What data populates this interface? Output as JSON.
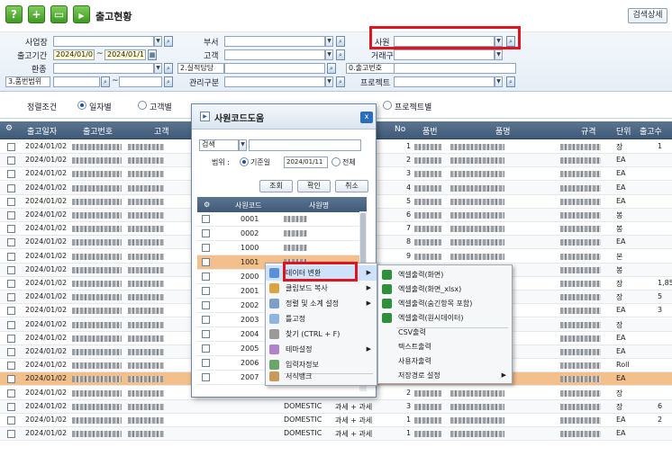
{
  "toolbar": {
    "help_label": "?",
    "add_label": "+",
    "page_title": "출고현황",
    "detail_search_label": "검색상세"
  },
  "filters": {
    "business_label": "사업장",
    "dept_label": "부서",
    "employee_label": "사원",
    "period_label": "출고기간",
    "date_from": "2024/01/01",
    "date_sep": "~",
    "date_to": "2024/01/11",
    "customer_label": "고객",
    "trade_type_label": "거래구분",
    "currency_label": "환종",
    "perf_owner_label": "2.실적담당",
    "ship_no_label": "0.출고번호",
    "item_range_label": "3.품번범위",
    "mgmt_type_label": "관리구분",
    "project_label": "프로젝트"
  },
  "sort": {
    "label": "정렬조건",
    "options": [
      "일자별",
      "고객별",
      "프로젝트별"
    ],
    "selected": "일자별"
  },
  "grid": {
    "columns": [
      "출고일자",
      "출고번호",
      "고객",
      "No",
      "품번",
      "품명",
      "규격",
      "단위",
      "출고수"
    ],
    "dates": [
      "2024/01/02",
      "2024/01/02",
      "2024/01/02",
      "2024/01/02",
      "2024/01/02",
      "2024/01/02",
      "2024/01/02",
      "2024/01/02",
      "2024/01/02",
      "2024/01/02",
      "2024/01/02",
      "2024/01/02",
      "2024/01/02",
      "2024/01/02",
      "2024/01/02",
      "2024/01/02",
      "2024/01/02",
      "2024/01/02",
      "2024/01/02",
      "2024/01/02",
      "2024/01/02",
      "2024/01/02"
    ],
    "nos": [
      "1",
      "2",
      "3",
      "4",
      "5",
      "6",
      "7",
      "8",
      "9",
      "1",
      "2",
      "1",
      "2",
      "3",
      "1",
      "2",
      "3",
      "1",
      "2",
      "3",
      "1",
      "1"
    ],
    "units": [
      "장",
      "EA",
      "EA",
      "EA",
      "EA",
      "봉",
      "봉",
      "EA",
      "본",
      "봉",
      "장",
      "장",
      "EA",
      "장",
      "EA",
      "EA",
      "Roll",
      "EA",
      "장",
      "장",
      "EA",
      "EA"
    ],
    "qtys": [
      "1",
      "",
      "",
      "",
      "",
      "",
      "",
      "",
      "",
      "",
      "1,85",
      "5",
      "3",
      "",
      "",
      "",
      "",
      "",
      "",
      "6",
      "2",
      ""
    ],
    "trade_type": "DOMESTIC",
    "tax_type": "과세 + 과세",
    "partial_customer": "인생구",
    "partial_code": "2179"
  },
  "popup": {
    "title": "사원코드도움",
    "close_label": "x",
    "search_type": "검색",
    "range_label": "범위 :",
    "base_date_label": "기준일",
    "base_date": "2024/01/11",
    "all_label": "전체",
    "btn_query": "조회",
    "btn_ok": "확인",
    "btn_cancel": "취소",
    "col_code": "사원코드",
    "col_name": "사원명",
    "codes": [
      "0001",
      "0002",
      "1000",
      "1001",
      "2000",
      "2001",
      "2002",
      "2003",
      "2004",
      "2005",
      "2006",
      "2007"
    ]
  },
  "context_menu": {
    "items": [
      "데이터 변환",
      "클립보드 복사",
      "정렬 및 소계 설정",
      "틀고정",
      "찾기 (CTRL + F)",
      "테마설정",
      "입력자정보",
      "서식뱅크"
    ]
  },
  "submenu": {
    "items": [
      "엑셀출력(화면)",
      "엑셀출력(화면_xlsx)",
      "엑셀출력(숨긴항목 포함)",
      "엑셀출력(원시데이터)",
      "CSV출력",
      "텍스트출력",
      "사용자출력",
      "저장경로 설정"
    ]
  },
  "colors": {
    "highlight": "#e0141e",
    "selected_row": "#f3c08c",
    "header_bg": "#4a6684"
  }
}
